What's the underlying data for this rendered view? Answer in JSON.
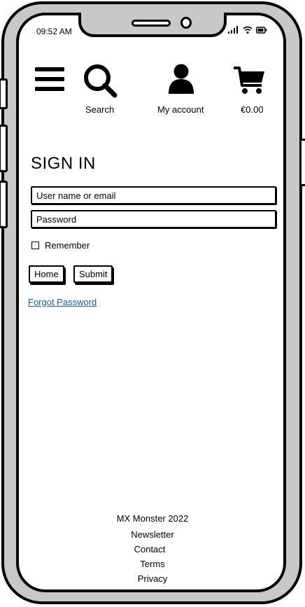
{
  "status_bar": {
    "time": "09:52 AM",
    "signal_icon": "signal-bars-icon",
    "wifi_icon": "wifi-icon",
    "battery_icon": "battery-icon"
  },
  "header": {
    "menu_icon": "hamburger-menu-icon",
    "search": {
      "icon": "search-icon",
      "label": "Search"
    },
    "account": {
      "icon": "user-icon",
      "label": "My account"
    },
    "cart": {
      "icon": "cart-icon",
      "label": "€0.00"
    }
  },
  "signin": {
    "title": "SIGN IN",
    "username_placeholder": "User name or email",
    "password_placeholder": "Password",
    "remember_label": "Remember",
    "home_button": "Home",
    "submit_button": "Submit",
    "forgot_link": "Forgot Password"
  },
  "footer": {
    "copyright": "MX Monster 2022",
    "links": [
      "Newsletter",
      "Contact",
      "Terms",
      "Privacy"
    ]
  },
  "colors": {
    "link": "#1a5aa8",
    "frame": "#c8c8c8"
  }
}
